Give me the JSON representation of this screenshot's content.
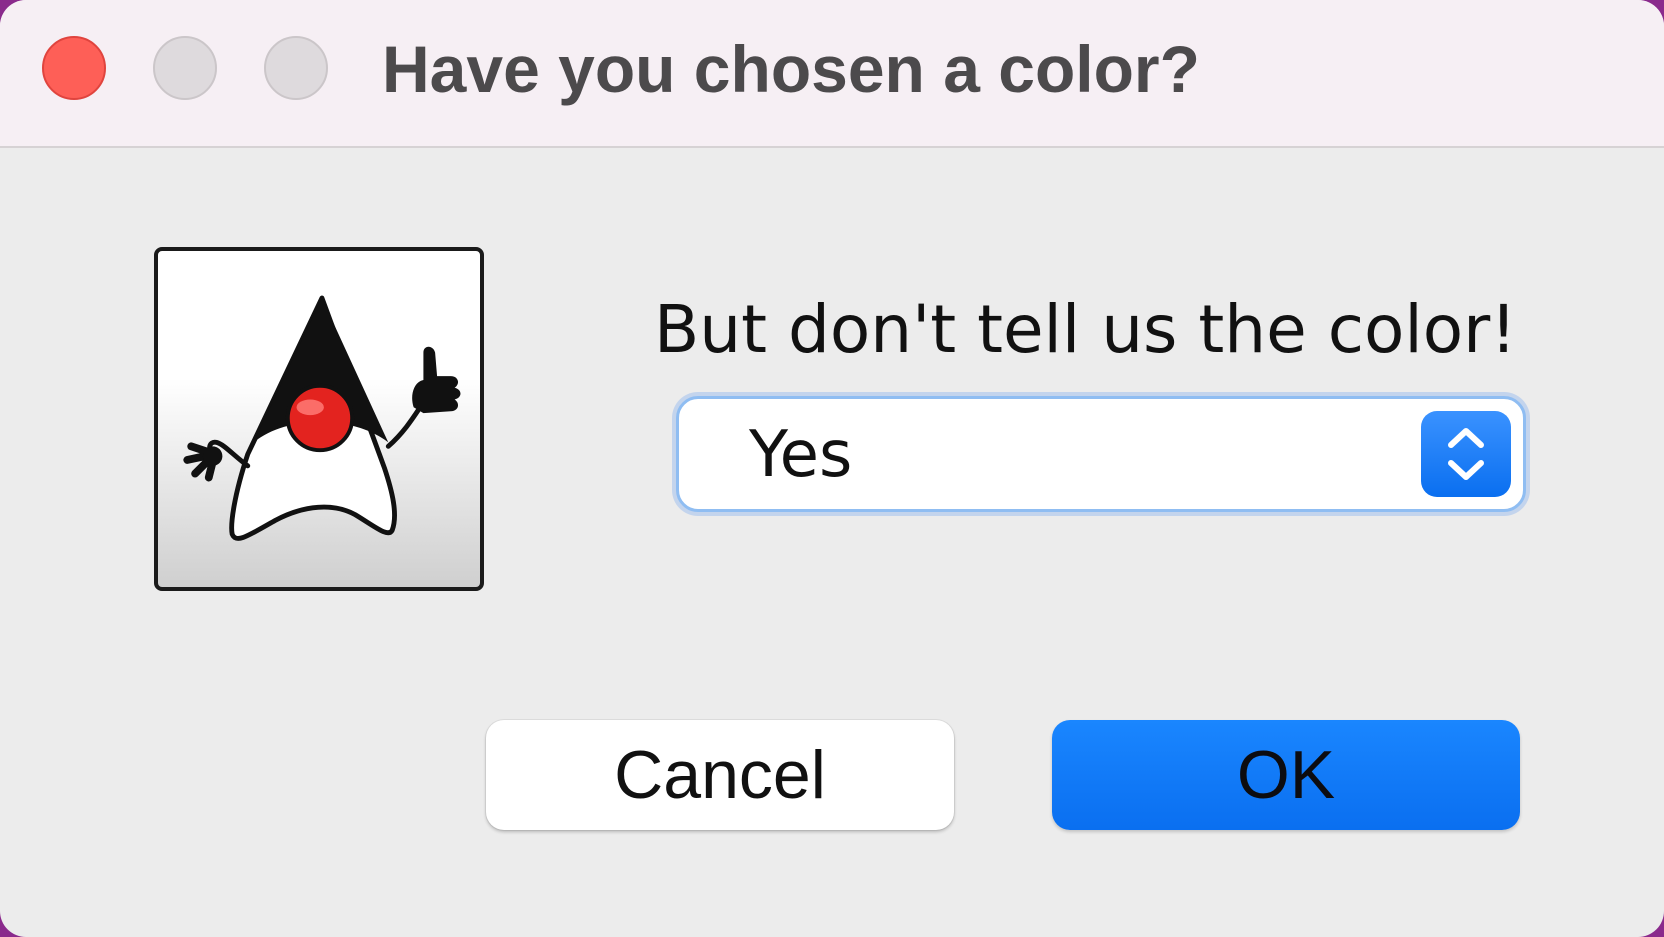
{
  "window": {
    "title": "Have you chosen a color?"
  },
  "dialog": {
    "message": "But don't tell us the color!",
    "combo": {
      "selected": "Yes"
    },
    "buttons": {
      "cancel_label": "Cancel",
      "ok_label": "OK"
    },
    "icon": "java-duke-icon"
  },
  "colors": {
    "titlebar_bg": "#f6eff4",
    "dialog_bg": "#ececec",
    "close_button": "#fe5f57",
    "accent_blue": "#0a6ff0",
    "focus_ring": "#8fbdf2"
  }
}
